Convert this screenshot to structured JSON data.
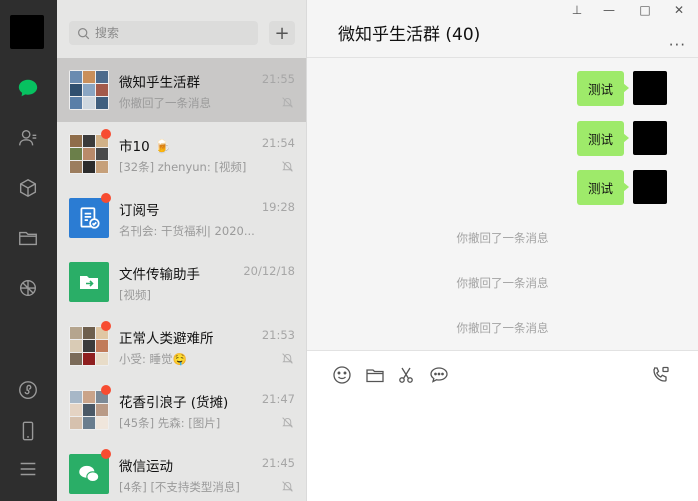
{
  "chat": {
    "title": "微知乎生活群 (40)",
    "messages_sent": [
      "测试",
      "测试",
      "测试"
    ],
    "recall_notices": [
      "你撤回了一条消息",
      "你撤回了一条消息",
      "你撤回了一条消息"
    ]
  },
  "search": {
    "placeholder": "搜索"
  },
  "add_button": "+",
  "conversations": [
    {
      "name": "微知乎生活群",
      "time": "21:55",
      "preview": "你撤回了一条消息",
      "muted": true,
      "badge": false,
      "active": true
    },
    {
      "name": "市10 🍺",
      "time": "21:54",
      "preview": "[32条] zhenyun: [视频]",
      "muted": true,
      "badge": true,
      "active": false
    },
    {
      "name": "订阅号",
      "time": "19:28",
      "preview": "名刊会: 干货福利| 2020...",
      "muted": false,
      "badge": true,
      "active": false
    },
    {
      "name": "文件传输助手",
      "time": "20/12/18",
      "preview": "[视频]",
      "muted": false,
      "badge": false,
      "active": false
    },
    {
      "name": "正常人类避难所",
      "time": "21:53",
      "preview": "小受: 睡觉🤤",
      "muted": true,
      "badge": true,
      "active": false
    },
    {
      "name": "花香引浪子 (货摊)",
      "time": "21:47",
      "preview": "[45条] 先森: [图片]",
      "muted": true,
      "badge": true,
      "active": false
    },
    {
      "name": "微信运动",
      "time": "21:45",
      "preview": "[4条] [不支持类型消息]",
      "muted": true,
      "badge": true,
      "active": false
    }
  ],
  "window_controls": {
    "pin": "⊥",
    "minimize": "—",
    "maximize": "□",
    "close": "✕"
  },
  "more_label": "···",
  "colors": {
    "accent_green": "#07c160",
    "bubble_green": "#9eea6a",
    "badge_red": "#f74c31"
  }
}
